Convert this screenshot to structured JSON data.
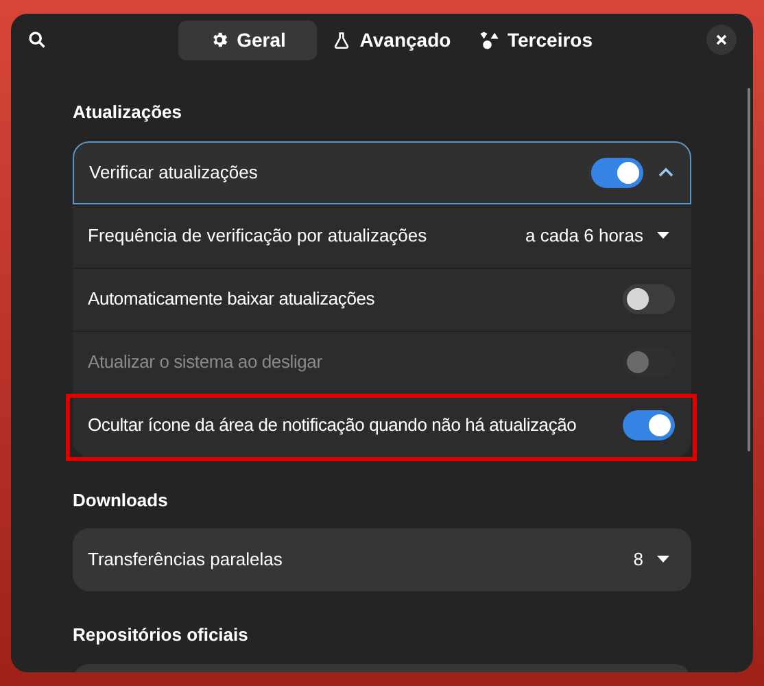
{
  "header": {
    "tabs": [
      {
        "label": "Geral",
        "selected": true
      },
      {
        "label": "Avançado",
        "selected": false
      },
      {
        "label": "Terceiros",
        "selected": false
      }
    ]
  },
  "sections": [
    {
      "title": "Atualizações",
      "rows": [
        {
          "kind": "expander",
          "label": "Verificar atualizações",
          "on": true,
          "expanded": true
        },
        {
          "kind": "dropdown",
          "label": "Frequência de verificação por atualizações",
          "value": "a cada 6 horas"
        },
        {
          "kind": "switch",
          "label": "Automaticamente baixar atualizações",
          "on": false,
          "disabled": false,
          "highlighted": false
        },
        {
          "kind": "switch",
          "label": "Atualizar o sistema ao desligar",
          "on": false,
          "disabled": true,
          "highlighted": false
        },
        {
          "kind": "switch",
          "label": "Ocultar ícone da área de notificação quando não há atualização",
          "on": true,
          "disabled": false,
          "highlighted": true
        }
      ]
    },
    {
      "title": "Downloads",
      "rows": [
        {
          "kind": "dropdown",
          "label": "Transferências paralelas",
          "value": "8"
        }
      ]
    },
    {
      "title": "Repositórios oficiais"
    }
  ]
}
